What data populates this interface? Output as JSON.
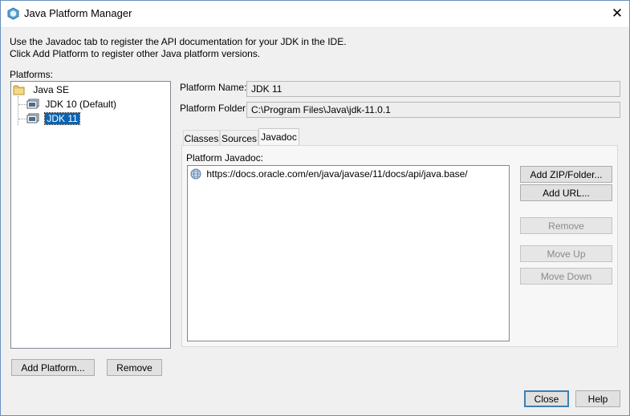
{
  "window": {
    "title": "Java Platform Manager"
  },
  "intro": {
    "line1": "Use the Javadoc tab to register the API documentation for your JDK in the IDE.",
    "line2": "Click Add Platform to register other Java platform versions."
  },
  "platforms": {
    "label": "Platforms:",
    "root": "Java SE",
    "items": [
      {
        "label": "JDK 10 (Default)",
        "selected": false
      },
      {
        "label": "JDK 11",
        "selected": true
      }
    ]
  },
  "details": {
    "name_label": "Platform Name:",
    "name_value": "JDK 11",
    "folder_label": "Platform Folder:",
    "folder_value": "C:\\Program Files\\Java\\jdk-11.0.1"
  },
  "tabs": [
    {
      "label": "Classes",
      "active": false
    },
    {
      "label": "Sources",
      "active": false
    },
    {
      "label": "Javadoc",
      "active": true
    }
  ],
  "javadoc": {
    "label": "Platform Javadoc:",
    "entries": [
      "https://docs.oracle.com/en/java/javase/11/docs/api/java.base/"
    ],
    "buttons": {
      "add_zip": "Add ZIP/Folder...",
      "add_url": "Add URL...",
      "remove": "Remove",
      "move_up": "Move Up",
      "move_down": "Move Down"
    }
  },
  "bottom": {
    "add_platform": "Add Platform...",
    "remove": "Remove",
    "close": "Close",
    "help": "Help"
  },
  "colors": {
    "selection": "#0a64b4",
    "default_button_border": "#3c7fb1",
    "window_border": "#6b8fbf"
  },
  "icons": [
    "app-logo-icon",
    "close-icon",
    "folder-icon",
    "platform-icon",
    "globe-icon"
  ]
}
